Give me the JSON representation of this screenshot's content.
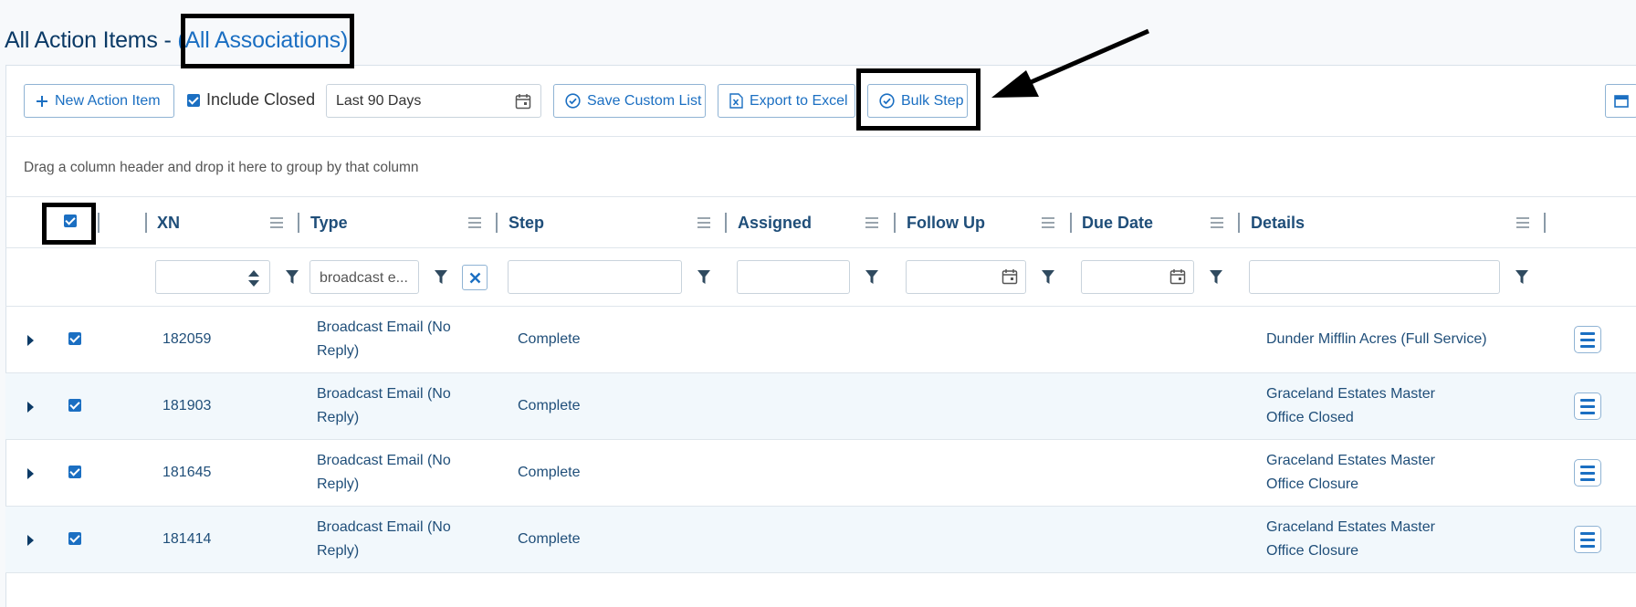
{
  "header": {
    "title": "All Action Items -",
    "scope_link": "(All Associations)"
  },
  "toolbar": {
    "new_action_label": "New Action Item",
    "include_closed_label": "Include Closed",
    "include_closed_checked": true,
    "date_range_value": "Last 90 Days",
    "save_custom_list_label": "Save Custom List",
    "export_excel_label": "Export to Excel",
    "bulk_step_label": "Bulk Step"
  },
  "grid": {
    "group_hint": "Drag a column header and drop it here to group by that column",
    "columns": {
      "xn": "XN",
      "type": "Type",
      "step": "Step",
      "assigned": "Assigned",
      "follow_up": "Follow Up",
      "due_date": "Due Date",
      "details": "Details"
    },
    "filters": {
      "type_value": "broadcast e..."
    },
    "rows": [
      {
        "xn": "182059",
        "type_line1": "Broadcast Email (No",
        "type_line2": "Reply)",
        "step": "Complete",
        "details_line1": "Dunder Mifflin Acres (Full Service)",
        "details_line2": ""
      },
      {
        "xn": "181903",
        "type_line1": "Broadcast Email (No",
        "type_line2": "Reply)",
        "step": "Complete",
        "details_line1": "Graceland Estates Master",
        "details_line2": "Office Closed"
      },
      {
        "xn": "181645",
        "type_line1": "Broadcast Email (No",
        "type_line2": "Reply)",
        "step": "Complete",
        "details_line1": "Graceland Estates Master",
        "details_line2": "Office Closure"
      },
      {
        "xn": "181414",
        "type_line1": "Broadcast Email (No",
        "type_line2": "Reply)",
        "step": "Complete",
        "details_line1": "Graceland Estates Master",
        "details_line2": "Office Closure"
      }
    ]
  },
  "colors": {
    "accent": "#1b6fc2",
    "title": "#0b3a66",
    "header_text": "#1f4e79",
    "alt_row": "#f2f8fc"
  }
}
